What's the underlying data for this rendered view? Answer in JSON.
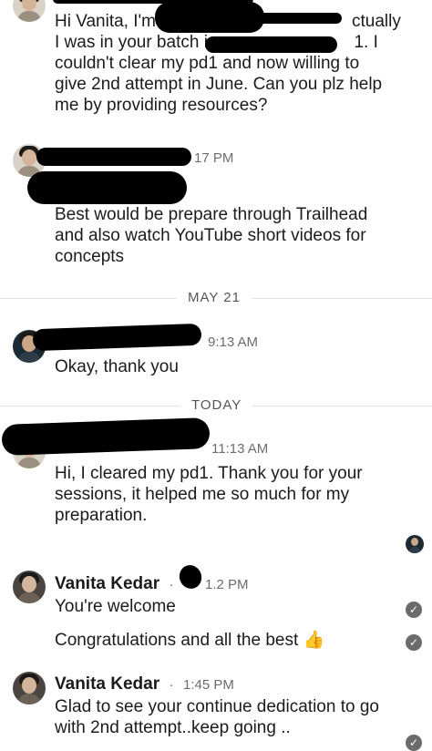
{
  "messages": {
    "m1": {
      "line1": "Hi Vanita, I'm",
      "line1b": "ctually",
      "line2": "I was in your batch in",
      "line2b": "1. I",
      "line3": "couldn't clear my pd1 and now willing to",
      "line4": "give 2nd attempt in June. Can you plz help",
      "line5": "me by providing resources?"
    },
    "m2": {
      "time": "17 PM",
      "line1": "Best would be prepare through Trailhead",
      "line2": "and also watch YouTube short videos for",
      "line3": "concepts"
    },
    "day1": "MAY 21",
    "m3": {
      "time": "9:13 AM",
      "text": "Okay, thank you"
    },
    "day2": "TODAY",
    "m4": {
      "time": "11:13 AM",
      "line1": "Hi, I cleared my pd1. Thank you for your",
      "line2": "sessions, it helped me so much for my",
      "line3": "preparation."
    },
    "m5": {
      "sender": "Vanita Kedar",
      "time": ".2 PM",
      "line1": "You're welcome",
      "line2": "Congratulations and all the best",
      "emoji": "👍"
    },
    "m6": {
      "sender": "Vanita Kedar",
      "time": "1:45 PM",
      "line1": "Glad to see your continue dedication to go",
      "line2": "with 2nd attempt..keep going .."
    }
  },
  "icons": {
    "read_check": "check-circle-icon",
    "thumbs_up": "thumbs-up-emoji"
  }
}
